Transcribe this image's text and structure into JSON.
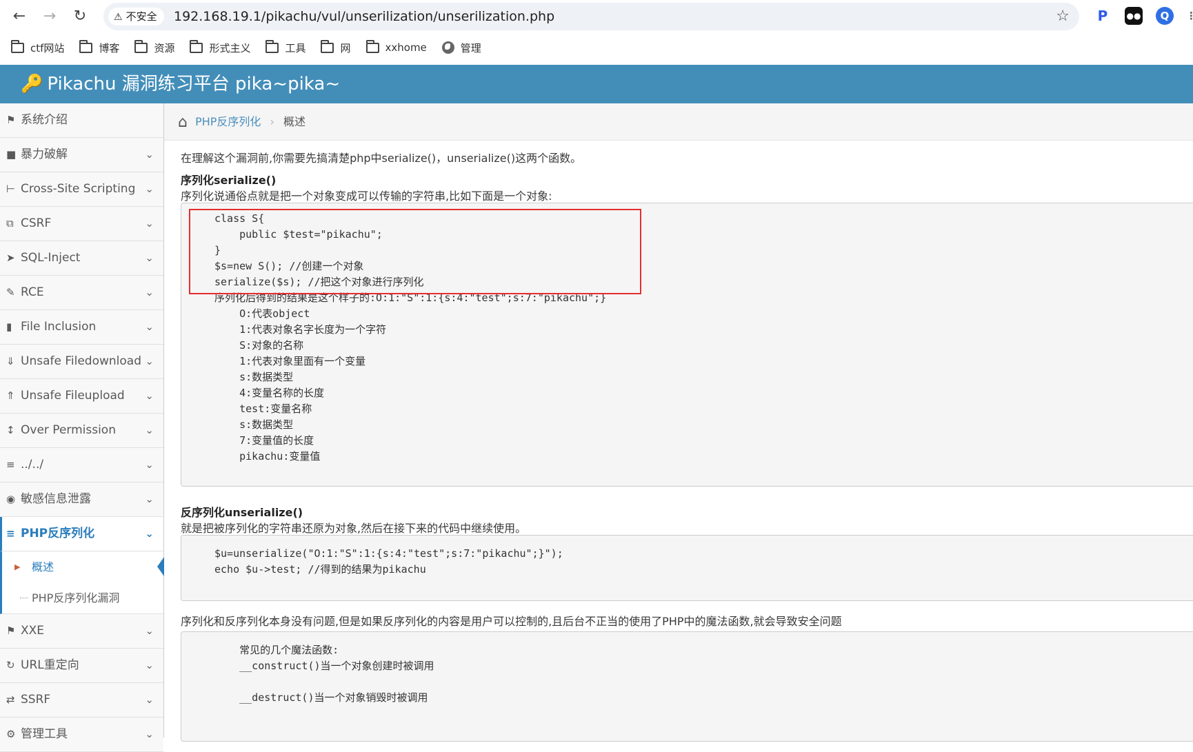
{
  "browser": {
    "security_label": "不安全",
    "url": "192.168.19.1/pikachu/vul/unserilization/unserilization.php",
    "bookmarks": [
      "ctf网站",
      "博客",
      "资源",
      "形式主义",
      "工具",
      "网",
      "xxhome",
      "管理"
    ]
  },
  "app": {
    "title": "Pikachu 漏洞练习平台 pika~pika~"
  },
  "sidebar": {
    "items": [
      {
        "label": "系统介绍",
        "icon": "tags-icon"
      },
      {
        "label": "暴力破解",
        "icon": "lock-icon"
      },
      {
        "label": "Cross-Site Scripting",
        "icon": "sitemap-icon"
      },
      {
        "label": "CSRF",
        "icon": "share-icon"
      },
      {
        "label": "SQL-Inject",
        "icon": "plane-icon"
      },
      {
        "label": "RCE",
        "icon": "pencil-icon"
      },
      {
        "label": "File Inclusion",
        "icon": "file-icon"
      },
      {
        "label": "Unsafe Filedownload",
        "icon": "download-icon"
      },
      {
        "label": "Unsafe Fileupload",
        "icon": "upload-icon"
      },
      {
        "label": "Over Permission",
        "icon": "text-height-icon"
      },
      {
        "label": "../../",
        "icon": "align-left-icon"
      },
      {
        "label": "敏感信息泄露",
        "icon": "camera-icon"
      },
      {
        "label": "PHP反序列化",
        "icon": "align-left-icon"
      },
      {
        "label": "XXE",
        "icon": "flag-icon"
      },
      {
        "label": "URL重定向",
        "icon": "refresh-icon"
      },
      {
        "label": "SSRF",
        "icon": "exchange-icon"
      },
      {
        "label": "管理工具",
        "icon": "gear-icon"
      }
    ],
    "submenu": [
      "概述",
      "PHP反序列化漏洞"
    ]
  },
  "breadcrumb": {
    "parent": "PHP反序列化",
    "current": "概述"
  },
  "content": {
    "intro": "在理解这个漏洞前,你需要先搞清楚php中serialize()，unserialize()这两个函数。",
    "serialize_heading": "序列化serialize()",
    "serialize_desc": "序列化说通俗点就是把一个对象变成可以传输的字符串,比如下面是一个对象:",
    "code1": "class S{\n    public $test=\"pikachu\";\n}\n$s=new S(); //创建一个对象\nserialize($s); //把这个对象进行序列化\n序列化后得到的结果是这个样子的:O:1:\"S\":1:{s:4:\"test\";s:7:\"pikachu\";}\n    O:代表object\n    1:代表对象名字长度为一个字符\n    S:对象的名称\n    1:代表对象里面有一个变量\n    s:数据类型\n    4:变量名称的长度\n    test:变量名称\n    s:数据类型\n    7:变量值的长度\n    pikachu:变量值",
    "unserialize_heading": "反序列化unserialize()",
    "unserialize_desc": "就是把被序列化的字符串还原为对象,然后在接下来的代码中继续使用。",
    "code2": "$u=unserialize(\"O:1:\"S\":1:{s:4:\"test\";s:7:\"pikachu\";}\");\necho $u->test; //得到的结果为pikachu",
    "problem_text": "序列化和反序列化本身没有问题,但是如果反序列化的内容是用户可以控制的,且后台不正当的使用了PHP中的魔法函数,就会导致安全问题",
    "code3": "    常见的几个魔法函数:\n    __construct()当一个对象创建时被调用\n\n    __destruct()当一个对象销毁时被调用"
  },
  "colors": {
    "header": "#438eb9",
    "active": "#2b7dbc",
    "highlight_border": "#e52d2d"
  }
}
